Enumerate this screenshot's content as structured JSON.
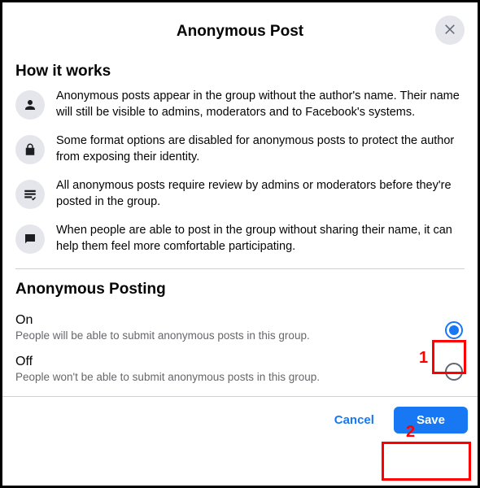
{
  "dialog": {
    "title": "Anonymous Post"
  },
  "howItWorks": {
    "heading": "How it works",
    "items": [
      {
        "icon": "person-icon",
        "text": "Anonymous posts appear in the group without the author's name. Their name will still be visible to admins, moderators and to Facebook's systems."
      },
      {
        "icon": "lock-icon",
        "text": "Some format options are disabled for anonymous posts to protect the author from exposing their identity."
      },
      {
        "icon": "review-icon",
        "text": "All anonymous posts require review by admins or moderators before they're posted in the group."
      },
      {
        "icon": "chat-icon",
        "text": "When people are able to post in the group without sharing their name, it can help them feel more comfortable participating."
      }
    ]
  },
  "anonPosting": {
    "heading": "Anonymous Posting",
    "options": {
      "on": {
        "label": "On",
        "desc": "People will be able to submit anonymous posts in this group.",
        "selected": true
      },
      "off": {
        "label": "Off",
        "desc": "People won't be able to submit anonymous posts in this group.",
        "selected": false
      }
    }
  },
  "footer": {
    "cancel": "Cancel",
    "save": "Save"
  },
  "annotations": {
    "n1": "1",
    "n2": "2"
  }
}
